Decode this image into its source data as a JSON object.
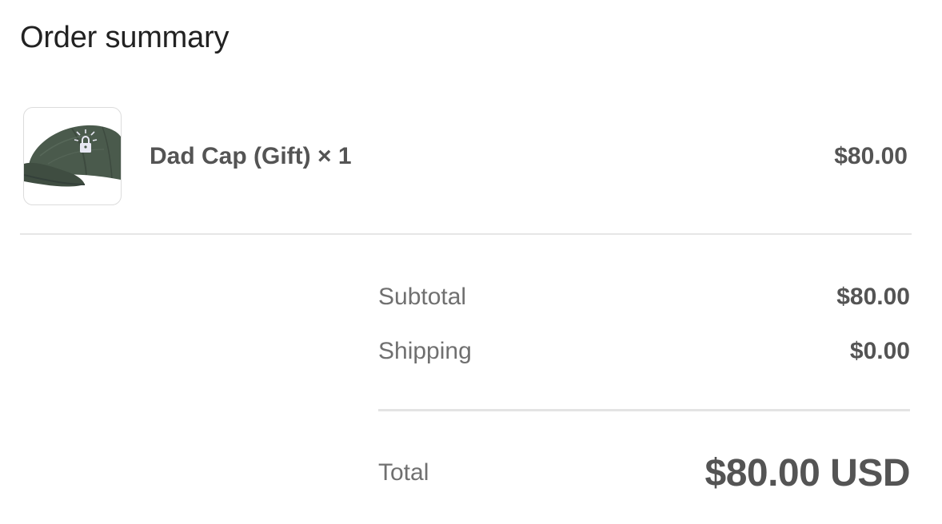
{
  "header": {
    "title": "Order summary"
  },
  "line_items": [
    {
      "name": "Dad Cap (Gift) × 1",
      "price": "$80.00",
      "image": "hat-thumbnail"
    }
  ],
  "summary": {
    "subtotal_label": "Subtotal",
    "subtotal_value": "$80.00",
    "shipping_label": "Shipping",
    "shipping_value": "$0.00",
    "total_label": "Total",
    "total_value": "$80.00 USD"
  },
  "colors": {
    "text_strong": "#545454",
    "text_muted": "#707070",
    "title": "#222222",
    "divider": "#e6e6e6",
    "cap_green": "#4a5a4c"
  }
}
